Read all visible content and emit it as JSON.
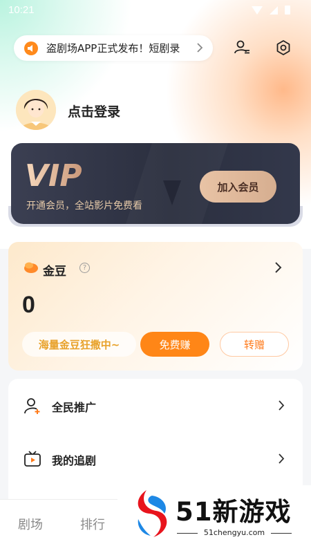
{
  "status_bar": {
    "time": "10:21"
  },
  "announcement": {
    "text": "盗剧场APP正式发布！短剧录"
  },
  "user": {
    "login_prompt": "点击登录"
  },
  "vip": {
    "logo_text": "VIP",
    "subtitle": "开通会员，全站影片免费看",
    "join_label": "加入会员"
  },
  "gold": {
    "title": "金豆",
    "help_symbol": "?",
    "balance": "0",
    "promo": "海量金豆狂撒中~",
    "earn_label": "免费赚",
    "gift_label": "转赠"
  },
  "menu": {
    "items": [
      {
        "label": "全民推广",
        "icon": "user-add-icon"
      },
      {
        "label": "我的追剧",
        "icon": "tv-play-icon"
      }
    ]
  },
  "tabs": [
    {
      "label": "剧场"
    },
    {
      "label": "排行"
    }
  ],
  "watermark": {
    "title": "51新游戏",
    "url": "51chengyu.com"
  },
  "colors": {
    "accent_orange": "#ff8617",
    "vip_dark": "#2b2f3f",
    "vip_gold": "#e8c3a5"
  }
}
